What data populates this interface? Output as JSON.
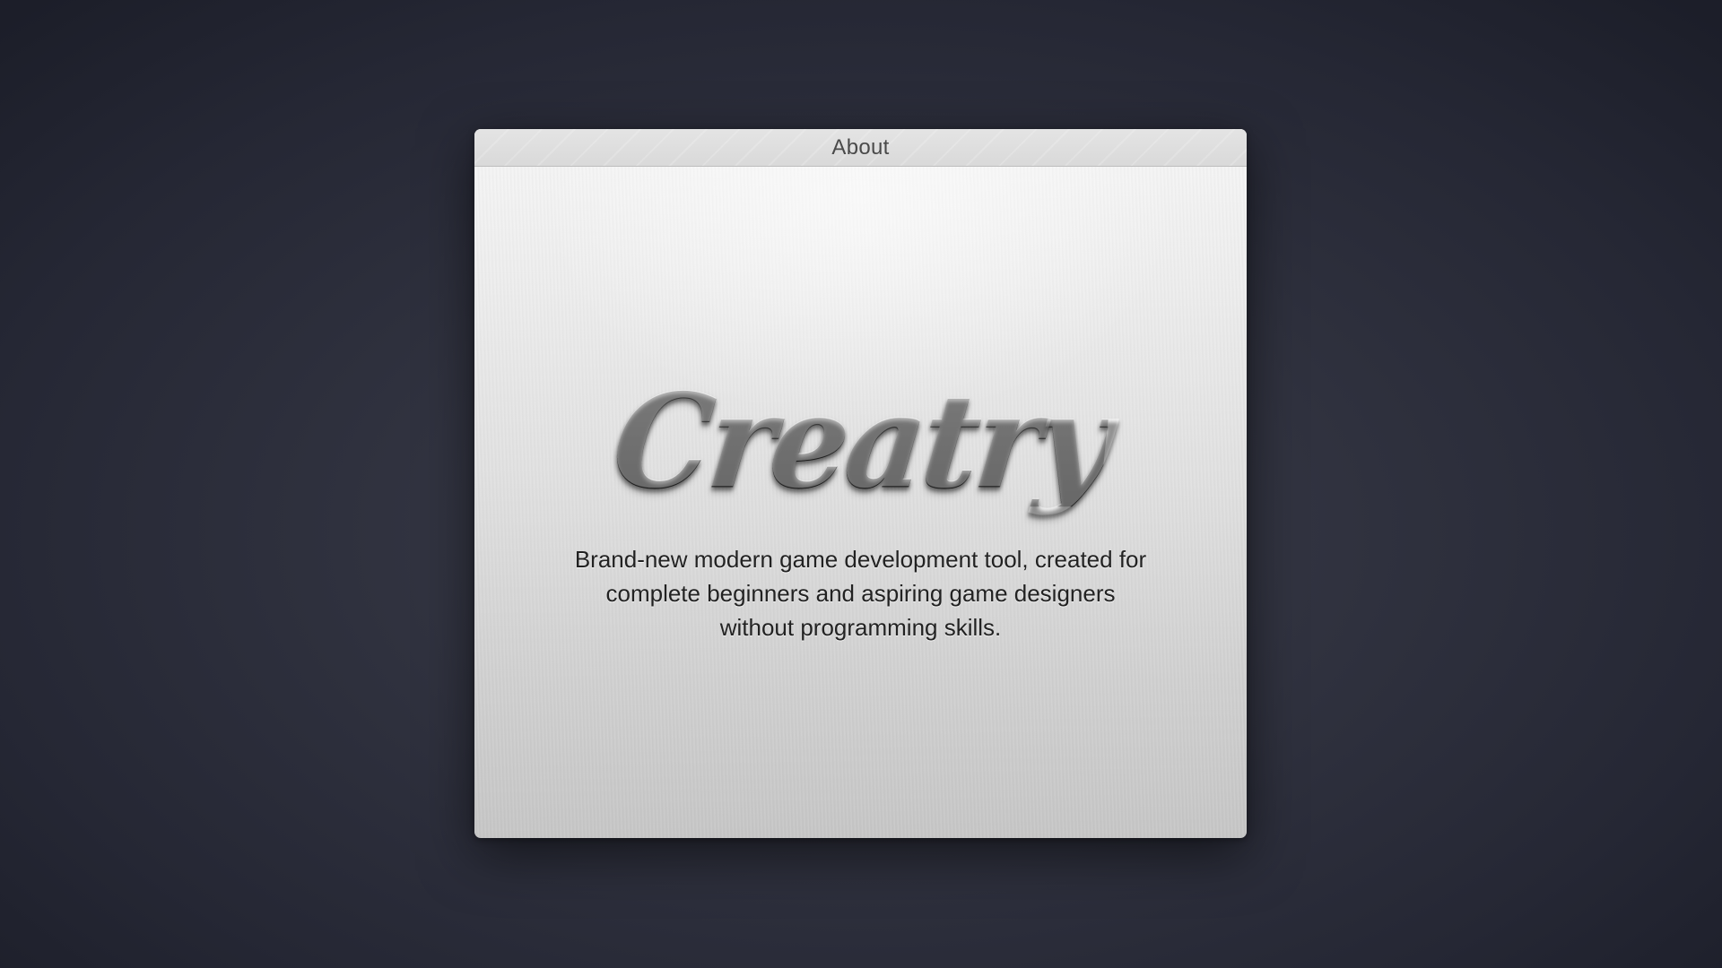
{
  "window": {
    "title": "About"
  },
  "about": {
    "app_name": "Creatry",
    "description_lines": [
      "Brand-new modern game development tool, created for",
      "complete beginners and aspiring game designers",
      "without programming skills."
    ]
  },
  "colors": {
    "background": "#2b2d3a",
    "window": "#e3e3e3",
    "titlebar": "#dcdcdc",
    "text": "#222222",
    "handle": "#636363"
  }
}
